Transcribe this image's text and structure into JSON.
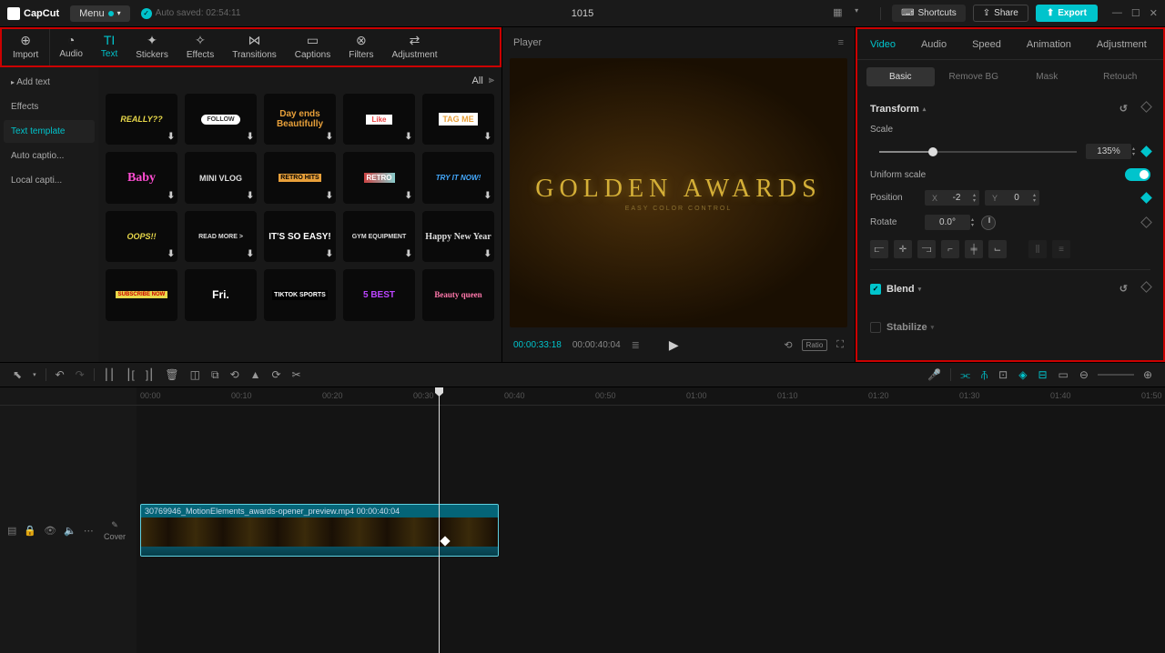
{
  "titlebar": {
    "app_name": "CapCut",
    "menu_label": "Menu",
    "autosave": "Auto saved: 02:54:11",
    "project_title": "1015",
    "shortcuts": "Shortcuts",
    "share": "Share",
    "export": "Export"
  },
  "tool_tabs": {
    "import": "Import",
    "items": [
      "Audio",
      "Text",
      "Stickers",
      "Effects",
      "Transitions",
      "Captions",
      "Filters",
      "Adjustment"
    ],
    "active": "Text"
  },
  "side_list": [
    "Add text",
    "Effects",
    "Text template",
    "Auto captio...",
    "Local capti..."
  ],
  "side_active": "Text template",
  "templates": {
    "all_label": "All",
    "items": [
      "REALLY??",
      "FOLLOW",
      "Day ends Beautifully",
      "Like",
      "TAG ME",
      "Baby",
      "MINI VLOG",
      "RETRO",
      "TRY IT NOW!",
      "OOPS!!",
      "READ MORE >",
      "IT'S SO EASY!",
      "GYM EQUIPMENT",
      "Happy New Year",
      "SUBSCRIBE NOW",
      "Fri.",
      "TIKTOK SPORTS",
      "5 BEST",
      "Beauty queen",
      "RETRO HITS"
    ]
  },
  "preview": {
    "title": "Player",
    "main_text": "GOLDEN AWARDS",
    "sub_text": "EASY COLOR CONTROL",
    "time_current": "00:00:33:18",
    "time_total": "00:00:40:04",
    "ratio_label": "Ratio"
  },
  "right_panel": {
    "tabs": [
      "Video",
      "Audio",
      "Speed",
      "Animation",
      "Adjustment"
    ],
    "active_tab": "Video",
    "sub_tabs": [
      "Basic",
      "Remove BG",
      "Mask",
      "Retouch"
    ],
    "active_sub": "Basic",
    "transform_label": "Transform",
    "scale_label": "Scale",
    "scale_value": "135%",
    "scale_pct": 27,
    "uniform_label": "Uniform scale",
    "position_label": "Position",
    "pos_x": "-2",
    "pos_y": "0",
    "rotate_label": "Rotate",
    "rotate_value": "0.0°",
    "blend_label": "Blend",
    "stabilize_label": "Stabilize"
  },
  "timeline": {
    "clip_label": "30769946_MotionElements_awards-opener_preview.mp4  00:00:40:04",
    "cover_label": "Cover",
    "ruler_ticks": [
      "00:00",
      "00:10",
      "00:20",
      "00:30",
      "00:40",
      "00:50",
      "01:00",
      "01:10",
      "01:20",
      "01:30",
      "01:40",
      "01:50"
    ]
  }
}
